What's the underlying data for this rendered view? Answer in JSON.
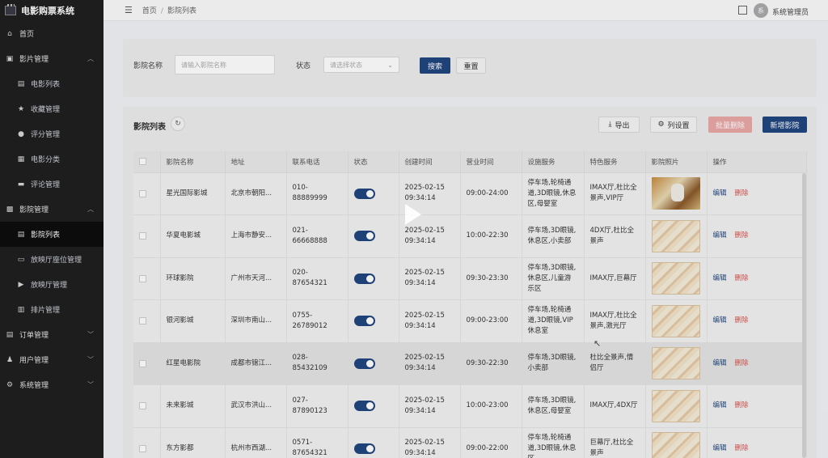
{
  "app": {
    "title": "电影购票系统"
  },
  "sidebar": {
    "items": [
      {
        "label": "首页",
        "icon": "home-icon",
        "level": "top"
      },
      {
        "label": "影片管理",
        "icon": "film-icon",
        "level": "top",
        "expanded": true
      },
      {
        "label": "电影列表",
        "icon": "list-icon",
        "level": "sub"
      },
      {
        "label": "收藏管理",
        "icon": "star-icon",
        "level": "sub"
      },
      {
        "label": "评分管理",
        "icon": "rating-icon",
        "level": "sub"
      },
      {
        "label": "电影分类",
        "icon": "grid-icon",
        "level": "sub"
      },
      {
        "label": "评论管理",
        "icon": "comment-icon",
        "level": "sub"
      },
      {
        "label": "影院管理",
        "icon": "cinema-icon",
        "level": "top",
        "expanded": true
      },
      {
        "label": "影院列表",
        "icon": "list-icon",
        "level": "sub",
        "active": true
      },
      {
        "label": "放映厅座位管理",
        "icon": "seat-icon",
        "level": "sub"
      },
      {
        "label": "放映厅管理",
        "icon": "video-icon",
        "level": "sub"
      },
      {
        "label": "排片管理",
        "icon": "calendar-icon",
        "level": "sub"
      },
      {
        "label": "订单管理",
        "icon": "order-icon",
        "level": "top"
      },
      {
        "label": "用户管理",
        "icon": "user-icon",
        "level": "top"
      },
      {
        "label": "系统管理",
        "icon": "gear-icon",
        "level": "top"
      }
    ]
  },
  "header": {
    "breadcrumb": [
      "首页",
      "影院列表"
    ],
    "avatar_text": "系",
    "username": "系统管理员"
  },
  "search": {
    "name_label": "影院名称",
    "name_placeholder": "请输入影院名称",
    "status_label": "状态",
    "status_placeholder": "请选择状态",
    "search_button": "搜索",
    "reset_button": "重置"
  },
  "list": {
    "title": "影院列表",
    "export_button": "导出",
    "columns_button": "列设置",
    "batch_delete_button": "批量删除",
    "add_button": "新增影院",
    "columns": [
      "影院名称",
      "地址",
      "联系电话",
      "状态",
      "创建时间",
      "营业时间",
      "设施服务",
      "特色服务",
      "影院照片",
      "操作"
    ],
    "edit_label": "编辑",
    "delete_label": "删除",
    "rows": [
      {
        "name": "星光国际影城",
        "address": "北京市朝阳...",
        "phone": "010-88889999",
        "created": [
          "2025-02-15",
          "09:34:14"
        ],
        "hours": "09:00-24:00",
        "facilities": "停车场,轮椅通道,3D眼镜,休息区,母婴室",
        "features": "IMAX厅,杜比全景声,VIP厅",
        "photo": "dog"
      },
      {
        "name": "华夏电影城",
        "address": "上海市静安...",
        "phone": "021-66668888",
        "created": [
          "2025-02-15",
          "09:34:14"
        ],
        "hours": "10:00-22:30",
        "facilities": "停车场,3D眼镜,休息区,小卖部",
        "features": "4DX厅,杜比全景声",
        "photo": "ticket"
      },
      {
        "name": "环球影院",
        "address": "广州市天河...",
        "phone": "020-87654321",
        "created": [
          "2025-02-15",
          "09:34:14"
        ],
        "hours": "09:30-23:30",
        "facilities": "停车场,3D眼镜,休息区,儿童游乐区",
        "features": "IMAX厅,巨幕厅",
        "photo": "ticket"
      },
      {
        "name": "银河影城",
        "address": "深圳市南山...",
        "phone": "0755-26789012",
        "created": [
          "2025-02-15",
          "09:34:14"
        ],
        "hours": "09:00-23:00",
        "facilities": "停车场,轮椅通道,3D眼镜,VIP休息室",
        "features": "IMAX厅,杜比全景声,激光厅",
        "photo": "ticket"
      },
      {
        "name": "红星电影院",
        "address": "成都市锦江...",
        "phone": "028-85432109",
        "created": [
          "2025-02-15",
          "09:34:14"
        ],
        "hours": "09:30-22:30",
        "facilities": "停车场,3D眼镜,小卖部",
        "features": "杜比全景声,情侣厅",
        "photo": "ticket"
      },
      {
        "name": "未来影城",
        "address": "武汉市洪山...",
        "phone": "027-87890123",
        "created": [
          "2025-02-15",
          "09:34:14"
        ],
        "hours": "10:00-23:00",
        "facilities": "停车场,3D眼镜,休息区,母婴室",
        "features": "IMAX厅,4DX厅",
        "photo": "ticket"
      },
      {
        "name": "东方影都",
        "address": "杭州市西湖...",
        "phone": "0571-87654321",
        "created": [
          "2025-02-15",
          "09:34:14"
        ],
        "hours": "09:00-22:00",
        "facilities": "停车场,轮椅通道,3D眼镜,休息区",
        "features": "巨幕厅,杜比全景声",
        "photo": "ticket"
      }
    ]
  },
  "colors": {
    "primary": "#20467f",
    "danger": "#d9534f",
    "sidebar": "#1f1f1f"
  }
}
